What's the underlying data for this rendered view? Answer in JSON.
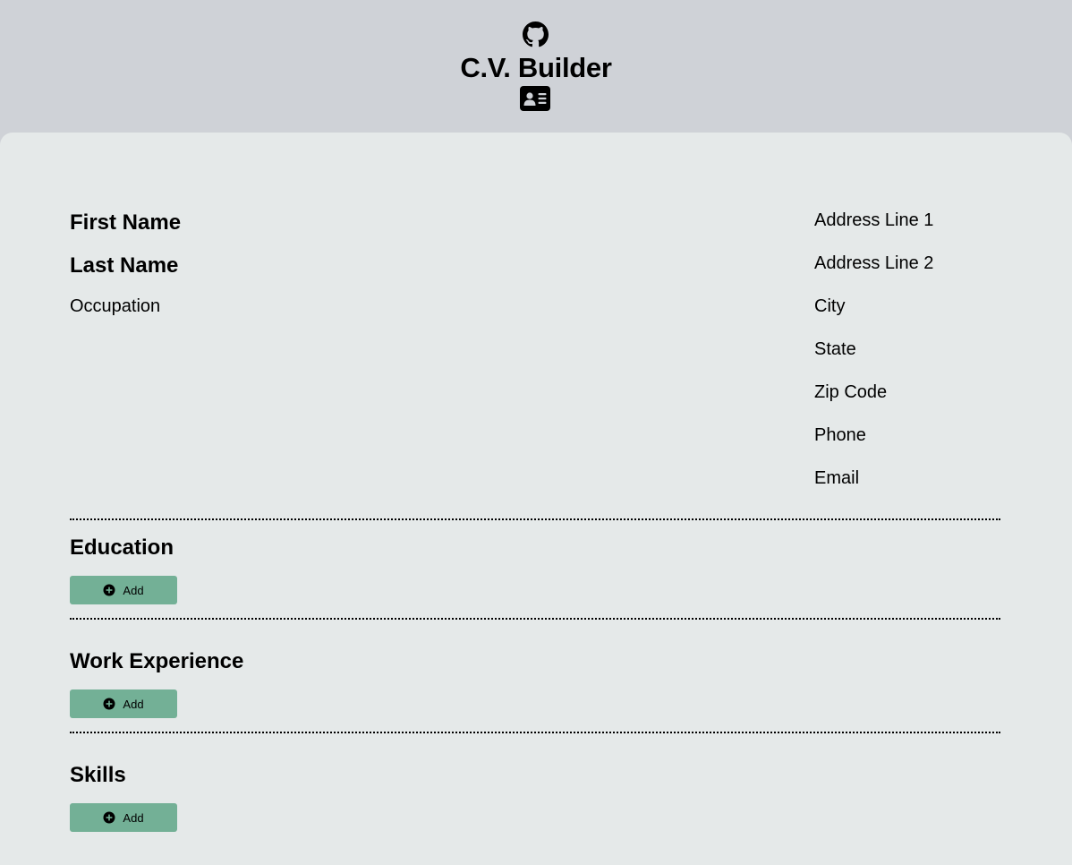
{
  "header": {
    "title": "C.V. Builder",
    "github_icon": "github-icon",
    "card_icon": "id-card-icon"
  },
  "personal": {
    "first_name": "First Name",
    "last_name": "Last Name",
    "occupation": "Occupation"
  },
  "contact": {
    "address_line_1": "Address Line 1",
    "address_line_2": "Address Line 2",
    "city": "City",
    "state": "State",
    "zip_code": "Zip Code",
    "phone": "Phone",
    "email": "Email"
  },
  "sections": {
    "education": {
      "title": "Education",
      "add_label": "Add"
    },
    "work": {
      "title": "Work Experience",
      "add_label": "Add"
    },
    "skills": {
      "title": "Skills",
      "add_label": "Add"
    }
  },
  "colors": {
    "header_bg": "#cfd2d7",
    "sheet_bg": "#e5e9e9",
    "button_bg": "#73b096"
  },
  "icons": {
    "add_button": "plus-circle-icon"
  }
}
